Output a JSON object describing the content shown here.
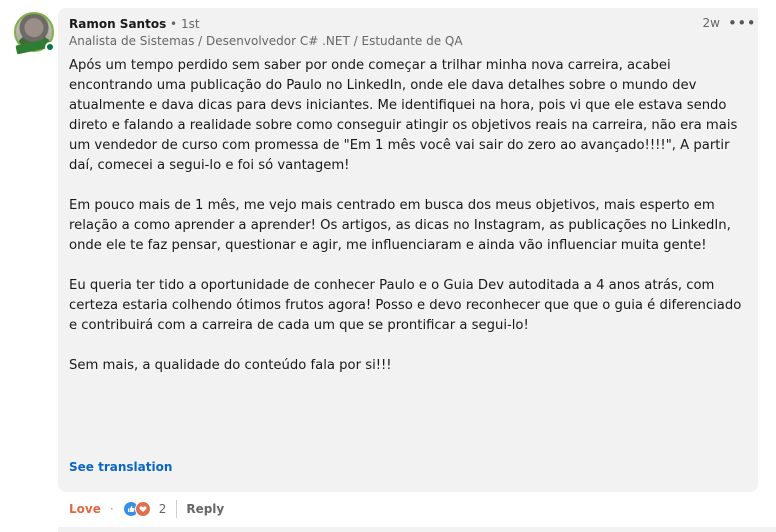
{
  "comment": {
    "author": {
      "name": "Ramon Santos",
      "degree": "• 1st",
      "headline": "Analista de Sistemas / Desenvolvedor C# .NET / Estudante de QA"
    },
    "timestamp": "2w",
    "more_icon": "•••",
    "paragraphs": [
      "Após um tempo perdido sem saber por onde começar a trilhar minha nova carreira, acabei encontrando uma publicação do Paulo no LinkedIn, onde ele dava detalhes sobre o mundo dev atualmente e dava dicas para devs iniciantes. Me identifiquei na hora, pois vi que ele estava sendo direto e falando a realidade sobre como conseguir atingir os objetivos reais na carreira, não era mais um vendedor de curso com promessa de \"Em 1 mês você vai sair do zero ao avançado!!!!\", A partir daí, comecei a segui-lo e foi só vantagem!",
      "Em pouco mais de 1 mês, me vejo mais centrado em busca dos meus objetivos, mais esperto em relação a como aprender a aprender! Os artigos, as dicas no Instagram, as publicações no LinkedIn, onde ele te faz pensar, questionar e agir, me influenciaram e ainda vão influenciar muita gente!",
      "Eu queria ter tido a oportunidade de conhecer Paulo e o Guia Dev autoditada a 4 anos atrás, com certeza estaria colhendo ótimos frutos agora! Posso e devo reconhecer que que o guia é diferenciado e contribuirá com a carreira de cada um que se prontificar a segui-lo!",
      "Sem mais, a qualidade do conteúdo fala por si!!!"
    ],
    "see_translation": "See translation"
  },
  "actions": {
    "reaction_label": "Love",
    "separator": "·",
    "reaction_count": "2",
    "reply_label": "Reply",
    "reaction_icons": [
      "like-icon",
      "love-icon"
    ]
  },
  "colors": {
    "love": "#e16745",
    "link": "#0a66c2",
    "online": "#057642",
    "comment_bg": "#f2f2f2"
  }
}
